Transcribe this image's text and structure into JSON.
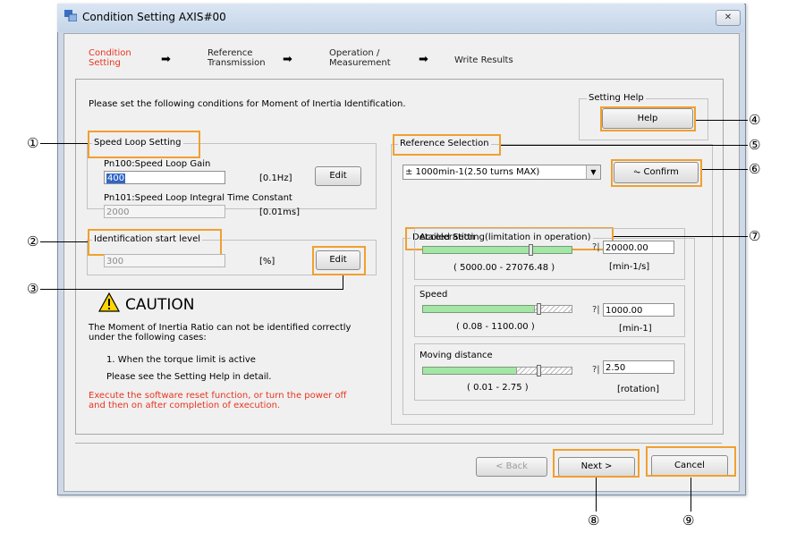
{
  "window": {
    "title": "Condition Setting AXIS#00",
    "close_glyph": "✕"
  },
  "steps": [
    {
      "line1": "Condition",
      "line2": "Setting"
    },
    {
      "line1": "Reference",
      "line2": "Transmission"
    },
    {
      "line1": "Operation /",
      "line2": "Measurement"
    },
    {
      "line1": "Write Results",
      "line2": ""
    }
  ],
  "intro": "Please set the following conditions for Moment of Inertia Identification.",
  "setting_help": {
    "label": "Setting Help",
    "button": "Help"
  },
  "speed_loop": {
    "label": "Speed Loop Setting",
    "gain_label": "Pn100:Speed Loop Gain",
    "gain_value": "400",
    "gain_unit": "[0.1Hz]",
    "edit": "Edit",
    "integral_label": "Pn101:Speed Loop Integral Time Constant",
    "integral_value": "2000",
    "integral_unit": "[0.01ms]"
  },
  "ident_start": {
    "label": "Identification start level",
    "value": "300",
    "unit": "[%]",
    "edit": "Edit"
  },
  "caution": {
    "title": "CAUTION",
    "text1": "The Moment of Inertia Ratio can not be identified correctly",
    "text2": "under the following cases:",
    "item1": "1. When the torque limit is active",
    "item2": "Please see the Setting Help in detail.",
    "warn1": "Execute the software reset function, or turn the power off",
    "warn2": "and then on after completion of execution."
  },
  "reference": {
    "label": "Reference Selection",
    "selected": "± 1000min-1(2.50 turns MAX)",
    "confirm": "Confirm"
  },
  "detailed": {
    "label": "Detailed Setting(limitation in operation)",
    "acceleration": {
      "label": "Acceleration",
      "value": "20000.00",
      "range": "( 5000.00 - 27076.48 )",
      "unit": "[min-1/s]",
      "level": 0.72
    },
    "speed": {
      "label": "Speed",
      "value": "1000.00",
      "range": "( 0.08 - 1100.00 )",
      "unit": "[min-1]",
      "level": 0.91
    },
    "distance": {
      "label": "Moving distance",
      "value": "2.50",
      "range": "( 0.01 - 2.75 )",
      "unit": "[rotation]",
      "level": 0.91
    },
    "help_glyph": "?|"
  },
  "footer": {
    "back": "< Back",
    "next": "Next >",
    "cancel": "Cancel"
  },
  "callouts": [
    "①",
    "②",
    "③",
    "④",
    "⑤",
    "⑥",
    "⑦",
    "⑧",
    "⑨"
  ],
  "colors": {
    "active_step": "#e8351f",
    "highlight": "#f0a030",
    "slider_fill": "#a3e6a5",
    "warning_text": "#e8351f"
  }
}
